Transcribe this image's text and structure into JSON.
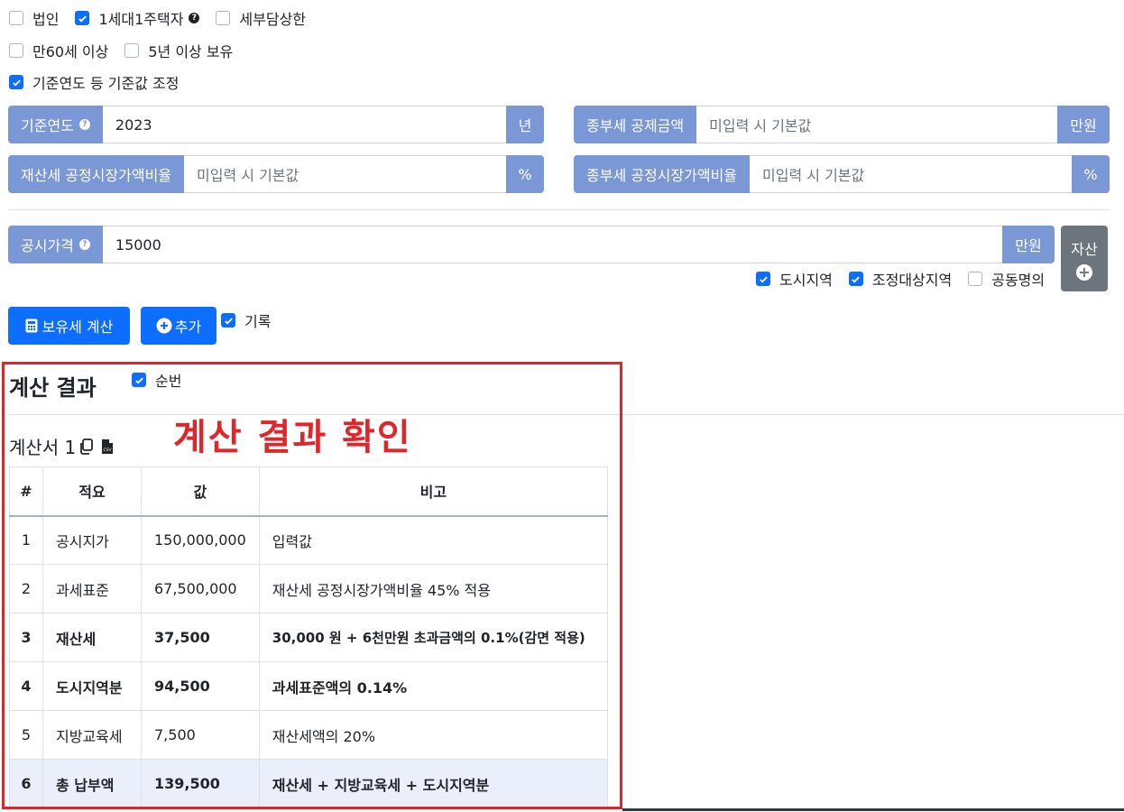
{
  "options": {
    "row1": [
      {
        "label": "법인",
        "checked": false
      },
      {
        "label": "1세대1주택자",
        "checked": true,
        "help": true
      },
      {
        "label": "세부담상한",
        "checked": false
      }
    ],
    "row2": [
      {
        "label": "만60세 이상",
        "checked": false
      },
      {
        "label": "5년 이상 보유",
        "checked": false
      }
    ],
    "row3": [
      {
        "label": "기준연도 등 기준값 조정",
        "checked": true
      }
    ]
  },
  "help_icon": "question-circle-icon",
  "inputs": {
    "base_year": {
      "label": "기준연도",
      "value": "2023",
      "unit": "년"
    },
    "comp_deduction": {
      "label": "종부세 공제금액",
      "placeholder": "미입력 시 기본값",
      "unit": "만원"
    },
    "prop_ratio": {
      "label": "재산세 공정시장가액비율",
      "placeholder": "미입력 시 기본값",
      "unit": "%"
    },
    "comp_ratio": {
      "label": "종부세 공정시장가액비율",
      "placeholder": "미입력 시 기본값",
      "unit": "%"
    },
    "public_price": {
      "label": "공시가격",
      "value": "15000",
      "unit": "만원"
    }
  },
  "price_options": [
    {
      "label": "도시지역",
      "checked": true
    },
    {
      "label": "조정대상지역",
      "checked": true
    },
    {
      "label": "공동명의",
      "checked": false
    }
  ],
  "asset_button": {
    "label": "자산",
    "icon": "plus-circle-icon"
  },
  "actions": {
    "calc_label": "보유세 계산",
    "calc_icon": "calculator-icon",
    "add_label": "추가",
    "add_icon": "plus-circle-icon",
    "record_label": "기록",
    "record_checked": true
  },
  "result": {
    "title": "계산 결과",
    "serial_label": "순번",
    "serial_checked": true,
    "annotation": "계산 결과 확인",
    "sheet_label": "계산서 1",
    "copy_icon": "copy-icon",
    "csv_icon": "csv-file-icon",
    "columns": [
      "#",
      "적요",
      "값",
      "비고"
    ],
    "rows": [
      {
        "no": "1",
        "item": "공시지가",
        "value": "150,000,000",
        "note": "입력값"
      },
      {
        "no": "2",
        "item": "과세표준",
        "value": "67,500,000",
        "note": "재산세 공정시장가액비율 45% 적용"
      },
      {
        "no": "3",
        "item": "재산세",
        "value": "37,500",
        "note": "30,000 원 + 6천만원 초과금액의 0.1%(감면 적용)"
      },
      {
        "no": "4",
        "item": "도시지역분",
        "value": "94,500",
        "note": "과세표준액의 0.14%"
      },
      {
        "no": "5",
        "item": "지방교육세",
        "value": "7,500",
        "note": "재산세액의 20%"
      },
      {
        "no": "6",
        "item": "총 납부액",
        "value": "139,500",
        "note": "재산세 + 지방교육세 + 도시지역분"
      }
    ]
  },
  "colors": {
    "accent": "#0d6efd",
    "addon": "#7a97d6",
    "highlight": "#e0262b"
  }
}
